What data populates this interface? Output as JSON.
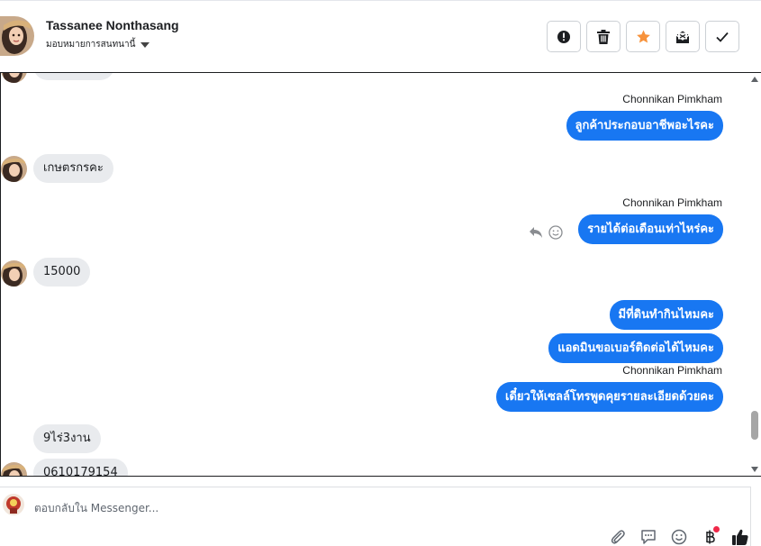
{
  "header": {
    "contact_name": "Tassanee Nonthasang",
    "assign_label": "มอบหมายการสนทนานี้",
    "actions": [
      {
        "name": "mark-spam-button",
        "icon": "alert-icon"
      },
      {
        "name": "delete-button",
        "icon": "trash-icon"
      },
      {
        "name": "star-button",
        "icon": "star-icon"
      },
      {
        "name": "mark-unread-button",
        "icon": "envelope-icon"
      },
      {
        "name": "mark-done-button",
        "icon": "check-icon"
      }
    ]
  },
  "conversation": {
    "partial_top_label": "",
    "sender_1": "Chonnikan Pimkham",
    "out_1": "ลูกค้าประกอบอาชีพอะไรคะ",
    "in_1": "เกษตรกรคะ",
    "sender_2": "Chonnikan Pimkham",
    "out_2": "รายได้ต่อเดือนเท่าไหร่คะ",
    "in_2": "15000",
    "out_3": "มีที่ดินทำกินไหมคะ",
    "out_4": "แอดมินขอเบอร์ติดต่อได้ไหมคะ",
    "sender_3": "Chonnikan Pimkham",
    "out_5": "เดี๋ยวให้เซลล์โทรพูดคุยรายละเอียดด้วยคะ",
    "in_3": "9ไร่3งาน",
    "in_4": "0610179154"
  },
  "composer": {
    "placeholder": "ตอบกลับใน Messenger..."
  },
  "colors": {
    "outgoing": "#1877f2",
    "incoming": "#e9ebee",
    "star": "#f7923b"
  }
}
